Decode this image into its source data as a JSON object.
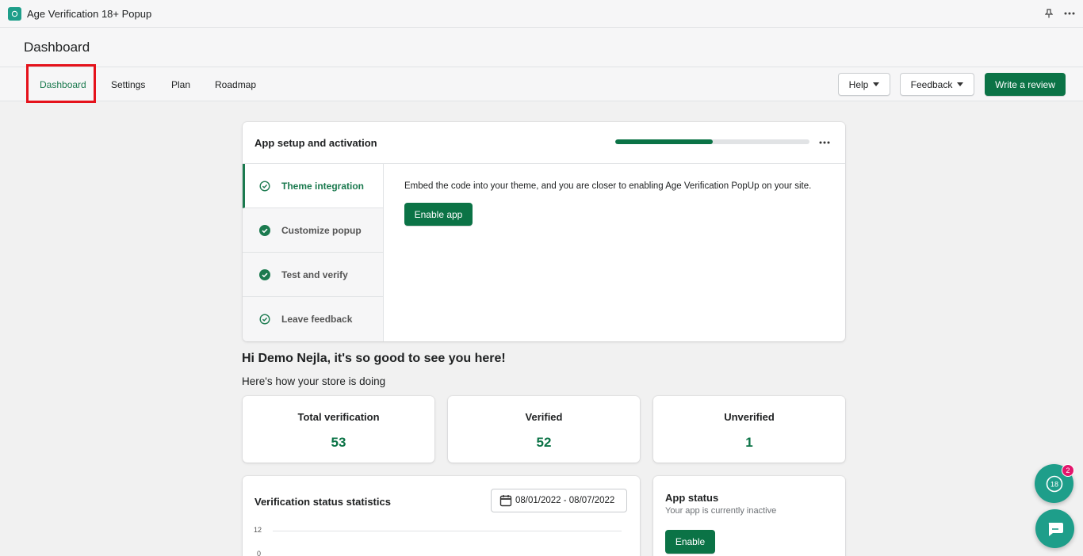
{
  "topbar": {
    "app_title": "Age Verification 18+ Popup"
  },
  "page": {
    "title": "Dashboard"
  },
  "nav": {
    "tabs": [
      {
        "label": "Dashboard",
        "active": true
      },
      {
        "label": "Settings"
      },
      {
        "label": "Plan"
      },
      {
        "label": "Roadmap"
      }
    ],
    "help_label": "Help",
    "feedback_label": "Feedback",
    "review_label": "Write a review"
  },
  "setup": {
    "title": "App setup and activation",
    "progress": 0.5,
    "steps": [
      {
        "label": "Theme integration",
        "state": "active"
      },
      {
        "label": "Customize popup",
        "state": "done"
      },
      {
        "label": "Test and verify",
        "state": "done"
      },
      {
        "label": "Leave feedback",
        "state": "pending"
      }
    ],
    "body_text": "Embed the code into your theme, and you are closer to enabling Age Verification PopUp on your site.",
    "button_label": "Enable app"
  },
  "greeting": {
    "title": "Hi Demo Nejla, it's so good to see you here!",
    "subtitle": "Here's how your store is doing"
  },
  "stats": [
    {
      "label": "Total verification",
      "value": "53"
    },
    {
      "label": "Verified",
      "value": "52"
    },
    {
      "label": "Unverified",
      "value": "1"
    }
  ],
  "chart_card": {
    "title": "Verification status statistics",
    "date_range": "08/01/2022 - 08/07/2022",
    "y_ticks": [
      "12",
      "0"
    ]
  },
  "app_status": {
    "title": "App status",
    "description": "Your app is currently inactive",
    "button_label": "Enable"
  },
  "floating": {
    "notification_count": "2"
  },
  "colors": {
    "primary": "#0b7346",
    "accent": "#1e9e8a",
    "highlight": "#e5121b"
  }
}
